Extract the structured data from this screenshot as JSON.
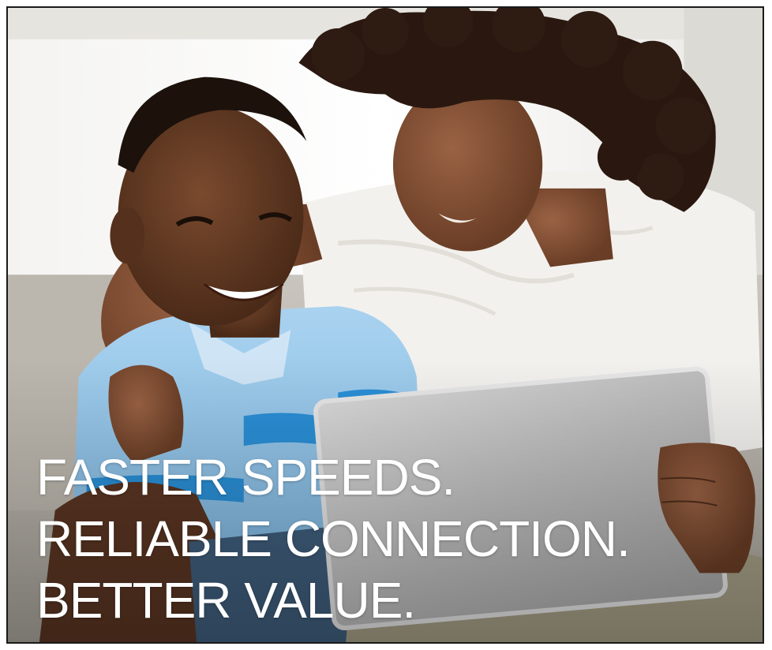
{
  "headline": {
    "line_1": "FASTER SPEEDS.",
    "line_2": "RELIABLE CONNECTION.",
    "line_3": "BETTER VALUE."
  },
  "colors": {
    "headline_text": "#ffffff",
    "border": "#1a1a1a",
    "background": "#ece9e4"
  },
  "photo": {
    "subject": "smiling boy and woman looking at a tablet on a couch"
  }
}
